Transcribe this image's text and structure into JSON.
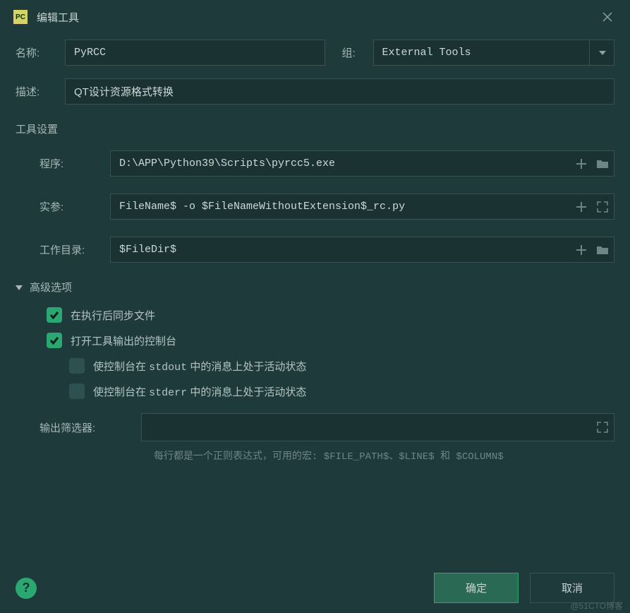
{
  "window": {
    "title": "编辑工具"
  },
  "labels": {
    "name": "名称:",
    "group": "组:",
    "description": "描述:",
    "tool_settings": "工具设置",
    "program": "程序:",
    "arguments": "实参:",
    "working_dir": "工作目录:",
    "advanced": "高级选项",
    "output_filter": "输出筛选器:"
  },
  "fields": {
    "name": "PyRCC",
    "group": "External Tools",
    "description": "QT设计资源格式转换",
    "program": "D:\\APP\\Python39\\Scripts\\pyrcc5.exe",
    "arguments": "FileName$ -o $FileNameWithoutExtension$_rc.py",
    "working_dir": "$FileDir$",
    "output_filter": ""
  },
  "checkboxes": {
    "sync_after": {
      "checked": true,
      "label": "在执行后同步文件"
    },
    "open_console": {
      "checked": true,
      "label": "打开工具输出的控制台"
    },
    "stdout_active": {
      "checked": false,
      "label_prefix": "使控制台在 ",
      "code": "stdout",
      "label_suffix": " 中的消息上处于活动状态"
    },
    "stderr_active": {
      "checked": false,
      "label_prefix": "使控制台在 ",
      "code": "stderr",
      "label_suffix": " 中的消息上处于活动状态"
    }
  },
  "hint": "每行都是一个正则表达式，可用的宏: $FILE_PATH$、$LINE$ 和 $COLUMN$",
  "buttons": {
    "ok": "确定",
    "cancel": "取消"
  },
  "watermark": "@51CTO博客"
}
